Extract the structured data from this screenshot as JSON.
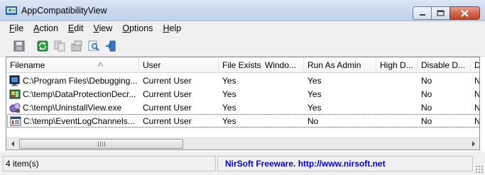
{
  "window": {
    "title": "AppCompatibilityView",
    "buttons": [
      "minimize",
      "maximize",
      "close"
    ]
  },
  "menu": [
    {
      "label": "File",
      "accel": "F",
      "rest": "ile"
    },
    {
      "label": "Action",
      "accel": "A",
      "rest": "ction"
    },
    {
      "label": "Edit",
      "accel": "E",
      "rest": "dit"
    },
    {
      "label": "View",
      "accel": "V",
      "rest": "iew"
    },
    {
      "label": "Options",
      "accel": "O",
      "rest": "ptions"
    },
    {
      "label": "Help",
      "accel": "H",
      "rest": "elp"
    }
  ],
  "toolbar": {
    "icons": [
      "save-icon",
      "refresh-icon",
      "copy-icon",
      "properties-icon",
      "find-icon",
      "exit-icon"
    ]
  },
  "columns": [
    "Filename",
    "User",
    "File Exists",
    "Windo...",
    "Run As Admin",
    "High D...",
    "Disable D...",
    "D"
  ],
  "rows": [
    {
      "icon": "debugger-app-icon",
      "filename": "C:\\Program Files\\Debugging...",
      "user": "Current User",
      "file_exists": "Yes",
      "windows": "",
      "run_as_admin": "Yes",
      "high_dpi": "",
      "disable_d": "No",
      "d": "N"
    },
    {
      "icon": "dataprotection-app-icon",
      "filename": "C:\\temp\\DataProtectionDecr...",
      "user": "Current User",
      "file_exists": "Yes",
      "windows": "",
      "run_as_admin": "Yes",
      "high_dpi": "",
      "disable_d": "No",
      "d": "N"
    },
    {
      "icon": "uninstallview-app-icon",
      "filename": "C:\\temp\\UninstallView.exe",
      "user": "Current User",
      "file_exists": "Yes",
      "windows": "",
      "run_as_admin": "Yes",
      "high_dpi": "",
      "disable_d": "No",
      "d": "N"
    },
    {
      "icon": "eventlogchannels-app-icon",
      "filename": "C:\\temp\\EventLogChannels...",
      "user": "Current User",
      "file_exists": "Yes",
      "windows": "",
      "run_as_admin": "No",
      "high_dpi": "",
      "disable_d": "No",
      "d": "N"
    }
  ],
  "status": {
    "items_count": "4 item(s)",
    "credit": "NirSoft Freeware.  http://www.nirsoft.net"
  },
  "colors": {
    "credit_link": "#0000ee",
    "titlebar": "#c9d9ee",
    "close_button": "#c5452a"
  }
}
